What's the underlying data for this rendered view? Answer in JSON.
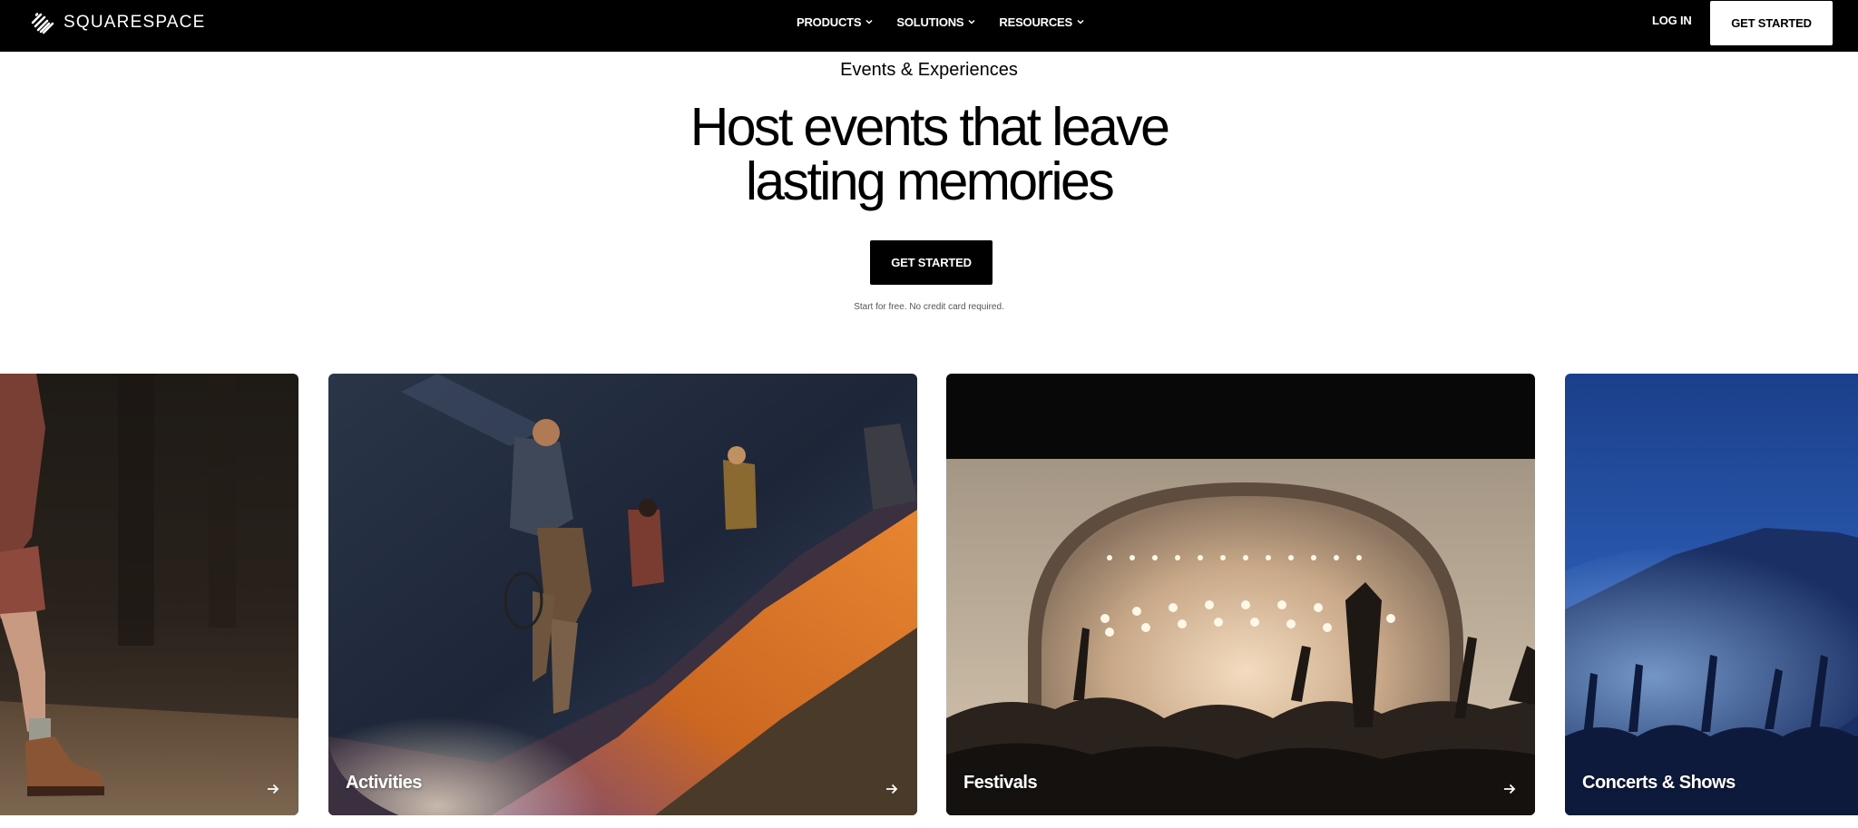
{
  "nav": {
    "logo_text": "SQUARESPACE",
    "menu": [
      {
        "label": "PRODUCTS"
      },
      {
        "label": "SOLUTIONS"
      },
      {
        "label": "RESOURCES"
      }
    ],
    "login_label": "LOG IN",
    "cta_label": "GET STARTED"
  },
  "hero": {
    "eyebrow": "Events & Experiences",
    "headline_line1": "Host events that leave",
    "headline_line2": "lasting memories",
    "cta_label": "GET STARTED",
    "note": "Start for free. No credit card required."
  },
  "cards": [
    {
      "label": ""
    },
    {
      "label": "Activities"
    },
    {
      "label": "Festivals"
    },
    {
      "label": "Concerts & Shows"
    }
  ],
  "icons": {
    "logo": "squarespace-logo-icon",
    "menu_chevron": "chevron-down-icon",
    "card_arrow": "arrow-right-icon"
  },
  "colors": {
    "nav_bg": "#000000",
    "page_bg": "#ffffff",
    "primary_button_bg": "#000000",
    "nav_button_bg": "#ffffff"
  }
}
